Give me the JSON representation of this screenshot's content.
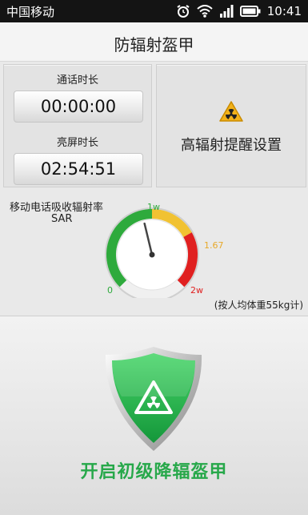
{
  "status_bar": {
    "carrier": "中国移动",
    "time": "10:41",
    "icons": [
      "alarm-clock-icon",
      "wifi-icon",
      "signal-icon",
      "battery-icon"
    ]
  },
  "header": {
    "title": "防辐射盔甲"
  },
  "timers": {
    "call_label": "通话时长",
    "call_value": "00:00:00",
    "screen_label": "亮屏时长",
    "screen_value": "02:54:51"
  },
  "high_radiation_settings": {
    "label": "高辐射提醒设置",
    "icon": "radiation-warning-icon"
  },
  "sar_meter": {
    "title": "移动电话吸收辐射率",
    "unit_label": "SAR",
    "tick_0": "0",
    "tick_1w": "1w",
    "tick_167w": "1.67w",
    "tick_2w": "2w",
    "note": "(按人均体重55kg计)",
    "value_w": 0.9,
    "max_w": 2,
    "colors": {
      "green": "#2eaa3c",
      "yellow": "#f1c232",
      "red": "#e02020"
    }
  },
  "shield": {
    "caption": "开启初级降辐盔甲",
    "icon": "shield-radiation-icon"
  }
}
